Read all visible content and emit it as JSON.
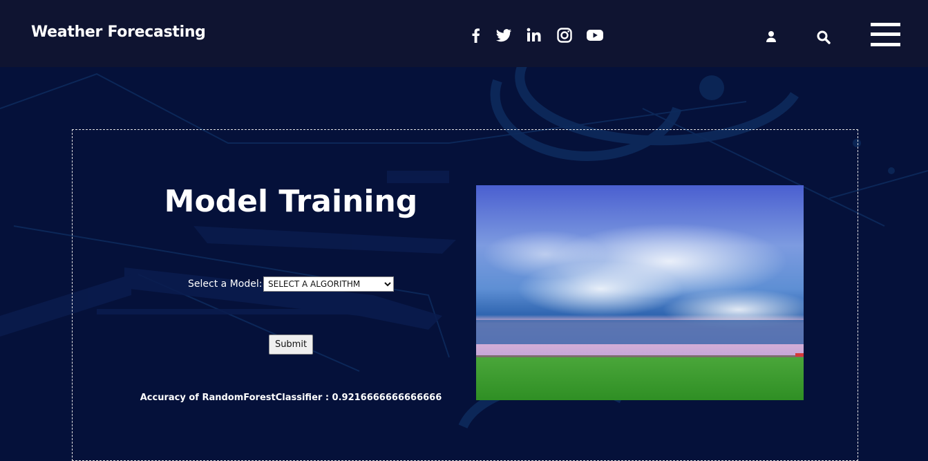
{
  "header": {
    "brand": "Weather Forecasting",
    "social_icons": [
      "facebook-icon",
      "twitter-icon",
      "linkedin-icon",
      "instagram-icon",
      "youtube-icon"
    ],
    "right_icons": [
      "user-icon",
      "search-icon",
      "menu-icon"
    ]
  },
  "main": {
    "title": "Model Training",
    "select_label": "Select a Model:",
    "select_value": "SELECT A ALGORITHM",
    "submit_label": "Submit",
    "result_text": "Accuracy of RandomForestClassifier : 0.9216666666666666"
  },
  "colors": {
    "header_bg": "#0f1431",
    "page_bg": "#05113a",
    "text": "#ffffff",
    "panel_border": "#e7e7e7"
  }
}
